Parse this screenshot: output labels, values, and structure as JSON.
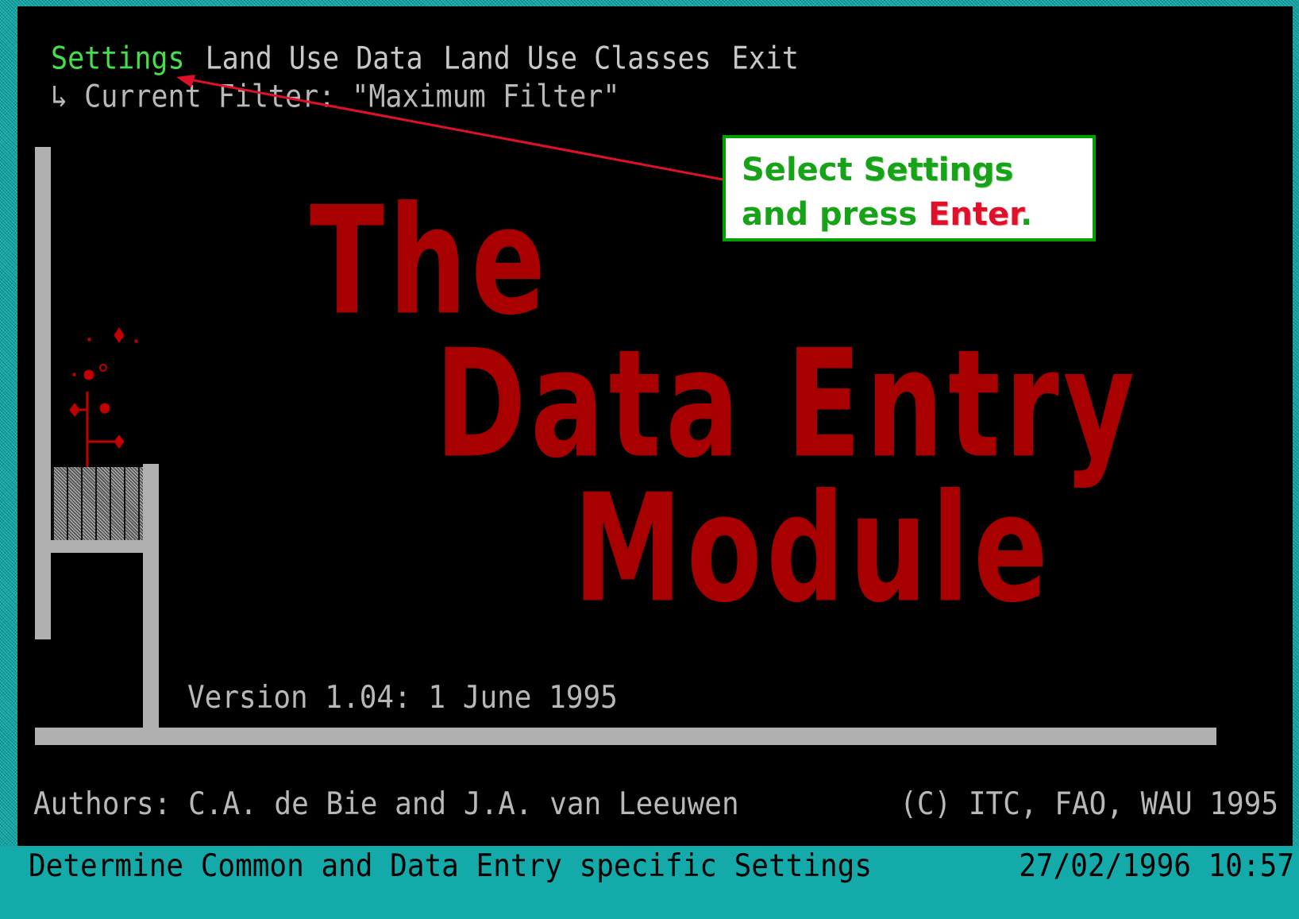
{
  "menu": {
    "items": [
      {
        "label": "Settings",
        "active": true
      },
      {
        "label": "Land Use Data",
        "active": false
      },
      {
        "label": "Land Use Classes",
        "active": false
      },
      {
        "label": "Exit",
        "active": false
      }
    ],
    "filter_line": "↳ Current Filter: \"Maximum Filter\""
  },
  "title": {
    "line1": "The",
    "line2": "Data Entry",
    "line3": "Module"
  },
  "version": "Version 1.04: 1 June 1995",
  "authors": "Authors: C.A. de Bie and J.A. van Leeuwen",
  "copyright": "(C) ITC, FAO, WAU 1995",
  "status": {
    "text": "Determine Common and Data Entry specific Settings",
    "datetime": "27/02/1996 10:57"
  },
  "callout": {
    "part1": "Select ",
    "keyword1": "Settings",
    "part2": " and press ",
    "keyword2": "Enter",
    "part3": "."
  },
  "colors": {
    "screen_bg": "#000000",
    "menu_active": "#44e04a",
    "title": "#a80000",
    "status_bg": "#15aaaa",
    "callout_border": "#00a000",
    "callout_text": "#17a317",
    "callout_keyword": "#e0102a",
    "arrow": "#e0102a"
  }
}
